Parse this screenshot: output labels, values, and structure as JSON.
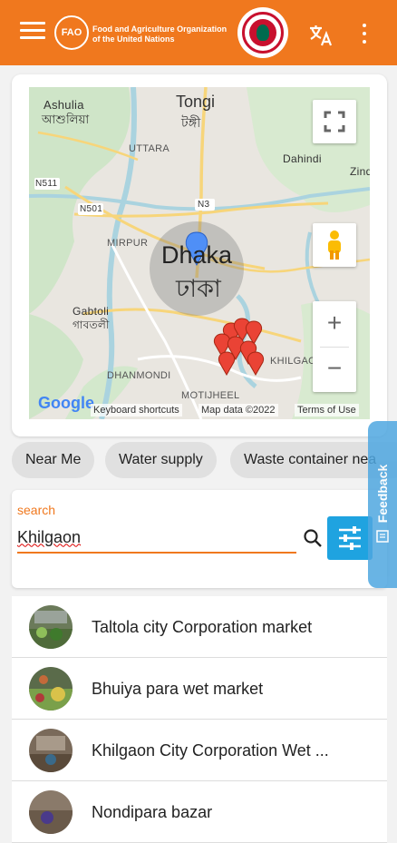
{
  "app_bar": {
    "background": "#f0781e",
    "menu_icon": "hamburger-menu-icon",
    "fao_logo_text": "FAO",
    "org_name": "Food and Agriculture Organization of the United Nations",
    "translate_icon": "translate-icon",
    "more_icon": "more-vertical-icon"
  },
  "map": {
    "labels": {
      "tongi_en": "Tongi",
      "tongi_bn": "টঙ্গী",
      "ashulia_en": "Ashulia",
      "ashulia_bn": "আশুলিয়া",
      "uttara": "UTTARA",
      "dahindi": "Dahindi",
      "zind": "Zind",
      "n511": "N511",
      "n501": "N501",
      "n3": "N3",
      "mirpur": "MIRPUR",
      "gabtoli_en": "Gabtoli",
      "gabtoli_bn": "গাবতলী",
      "dhaka_en": "Dhaka",
      "dhaka_bn": "ঢাকা",
      "dhanmondi": "DHANMONDI",
      "motijheel": "MOTIJHEEL",
      "khilgaon": "KHILGAON"
    },
    "google_logo": "Google",
    "attribution": {
      "keyboard": "Keyboard shortcuts",
      "data": "Map data ©2022",
      "terms": "Terms of Use"
    },
    "zoom_in": "+",
    "zoom_out": "−"
  },
  "chips": [
    "Near Me",
    "Water supply",
    "Waste container nea"
  ],
  "search": {
    "label": "search",
    "value": "Khilgaon",
    "accent": "#f0781e",
    "filter_color": "#1fa3e0"
  },
  "feedback": {
    "label": "Feedback"
  },
  "list": [
    {
      "label": "Taltola city Corporation market"
    },
    {
      "label": "Bhuiya para wet market"
    },
    {
      "label": "Khilgaon City Corporation Wet ..."
    },
    {
      "label": "Nondipara bazar"
    }
  ]
}
